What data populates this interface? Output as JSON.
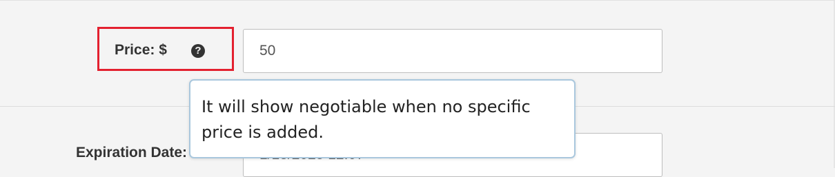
{
  "price_field": {
    "label": "Price: $",
    "help_icon": "question-circle-icon",
    "value": "50"
  },
  "expiration_field": {
    "label": "Expiration Date:",
    "value": "1/18/2025 12:07"
  },
  "tooltip": {
    "text": "It will show negotiable when no specific price is added."
  },
  "colors": {
    "highlight_border": "#e3202f",
    "tooltip_border": "#a9c7dd",
    "background": "#f4f4f4"
  }
}
